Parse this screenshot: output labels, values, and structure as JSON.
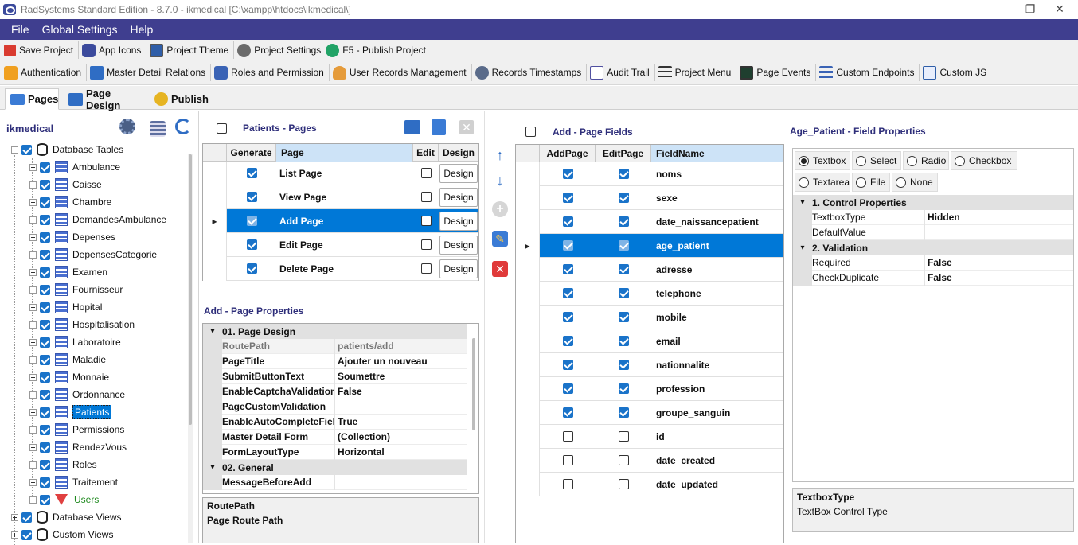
{
  "window": {
    "title": "RadSystems Standard Edition - 8.7.0 - ikmedical [C:\\xampp\\htdocs\\ikmedical\\]"
  },
  "menu": [
    "File",
    "Global Settings",
    "Help"
  ],
  "toolbar1": [
    {
      "label": "Save Project",
      "icon": "save-icon"
    },
    {
      "label": "App Icons",
      "icon": "app-icons-icon"
    },
    {
      "label": "Project Theme",
      "icon": "theme-icon"
    },
    {
      "label": "Project Settings",
      "icon": "gear-icon"
    },
    {
      "label": "F5 - Publish Project",
      "icon": "play-icon"
    }
  ],
  "toolbar2": [
    {
      "label": "Authentication",
      "icon": "lock-icon"
    },
    {
      "label": "Master Detail Relations",
      "icon": "table-icon"
    },
    {
      "label": "Roles and Permission",
      "icon": "roles-icon"
    },
    {
      "label": "User Records Management",
      "icon": "user-icon"
    },
    {
      "label": "Records Timestamps",
      "icon": "gears-icon"
    },
    {
      "label": "Audit Trail",
      "icon": "checklist-icon"
    },
    {
      "label": "Project Menu",
      "icon": "menu-icon"
    },
    {
      "label": "Page Events",
      "icon": "monitor-icon"
    },
    {
      "label": "Custom Endpoints",
      "icon": "list-icon"
    },
    {
      "label": "Custom JS",
      "icon": "code-icon"
    }
  ],
  "tabs": [
    "Pages",
    "Page Design",
    "Publish"
  ],
  "project": {
    "name": "ikmedical",
    "root_database_tables": "Database Tables",
    "tables": [
      "Ambulance",
      "Caisse",
      "Chambre",
      "DemandesAmbulance",
      "Depenses",
      "DepensesCategorie",
      "Examen",
      "Fournisseur",
      "Hopital",
      "Hospitalisation",
      "Laboratoire",
      "Maladie",
      "Monnaie",
      "Ordonnance",
      "Patients",
      "Permissions",
      "RendezVous",
      "Roles",
      "Traitement",
      "Users"
    ],
    "selected_table": "Patients",
    "database_views": "Database Views",
    "custom_views": "Custom Views"
  },
  "pages_panel": {
    "title": "Patients - Pages",
    "headers": [
      "Generate",
      "Page",
      "Edit",
      "Design"
    ],
    "design_label": "Design",
    "rows": [
      {
        "page": "List Page",
        "generate": true,
        "edit": false
      },
      {
        "page": "View Page",
        "generate": true,
        "edit": false
      },
      {
        "page": "Add Page",
        "generate": true,
        "edit": false,
        "selected": true
      },
      {
        "page": "Edit Page",
        "generate": true,
        "edit": false
      },
      {
        "page": "Delete Page",
        "generate": true,
        "edit": false
      }
    ]
  },
  "page_properties": {
    "title": "Add - Page Properties",
    "categories": [
      {
        "name": "01. Page Design",
        "rows": [
          {
            "k": "RoutePath",
            "v": "patients/add",
            "readonly": true
          },
          {
            "k": "PageTitle",
            "v": "Ajouter un nouveau"
          },
          {
            "k": "SubmitButtonText",
            "v": "Soumettre"
          },
          {
            "k": "EnableCaptchaValidation",
            "v": "False"
          },
          {
            "k": "PageCustomValidation",
            "v": ""
          },
          {
            "k": "EnableAutoCompleteFiel",
            "v": "True"
          },
          {
            "k": "Master Detail Form",
            "v": "(Collection)"
          },
          {
            "k": "FormLayoutType",
            "v": "Horizontal"
          }
        ]
      },
      {
        "name": "02. General",
        "rows": [
          {
            "k": "MessageBeforeAdd",
            "v": ""
          }
        ]
      }
    ],
    "help_title": "RoutePath",
    "help_desc": "Page Route Path"
  },
  "fields_panel": {
    "title": "Add - Page Fields",
    "headers": [
      "AddPage",
      "EditPage",
      "FieldName"
    ],
    "rows": [
      {
        "name": "noms",
        "add": true,
        "edit": true
      },
      {
        "name": "sexe",
        "add": true,
        "edit": true
      },
      {
        "name": "date_naissancepatient",
        "add": true,
        "edit": true
      },
      {
        "name": "age_patient",
        "add": true,
        "edit": true,
        "selected": true
      },
      {
        "name": "adresse",
        "add": true,
        "edit": true
      },
      {
        "name": "telephone",
        "add": true,
        "edit": true
      },
      {
        "name": "mobile",
        "add": true,
        "edit": true
      },
      {
        "name": "email",
        "add": true,
        "edit": true
      },
      {
        "name": "nationnalite",
        "add": true,
        "edit": true
      },
      {
        "name": "profession",
        "add": true,
        "edit": true
      },
      {
        "name": "groupe_sanguin",
        "add": true,
        "edit": true
      },
      {
        "name": "id",
        "add": false,
        "edit": false
      },
      {
        "name": "date_created",
        "add": false,
        "edit": false
      },
      {
        "name": "date_updated",
        "add": false,
        "edit": false
      }
    ]
  },
  "field_properties": {
    "title": "Age_Patient - Field Properties",
    "controls_row1": [
      "Textbox",
      "Select",
      "Radio",
      "Checkbox"
    ],
    "controls_row2": [
      "Textarea",
      "File",
      "None"
    ],
    "selected_control": "Textbox",
    "categories": [
      {
        "name": "1. Control Properties",
        "rows": [
          {
            "k": "TextboxType",
            "v": "Hidden"
          },
          {
            "k": "DefaultValue",
            "v": ""
          }
        ]
      },
      {
        "name": "2. Validation",
        "rows": [
          {
            "k": "Required",
            "v": "False"
          },
          {
            "k": "CheckDuplicate",
            "v": "False"
          }
        ]
      }
    ],
    "help_title": "TextboxType",
    "help_desc": "TextBox Control Type"
  }
}
